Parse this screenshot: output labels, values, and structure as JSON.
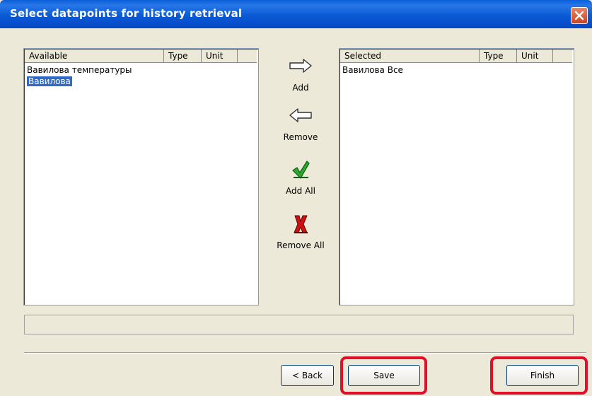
{
  "window": {
    "title": "Select datapoints for history retrieval"
  },
  "available": {
    "headers": [
      "Available",
      "Type",
      "Unit"
    ],
    "items": [
      {
        "label": "Вавилова температуры",
        "selected": false
      },
      {
        "label": "Вавилова",
        "selected": true
      }
    ]
  },
  "selected": {
    "headers": [
      "Selected",
      "Type",
      "Unit"
    ],
    "items": [
      {
        "label": "Вавилова Все"
      }
    ]
  },
  "actions": {
    "add": "Add",
    "remove": "Remove",
    "add_all": "Add All",
    "remove_all": "Remove All"
  },
  "footer": {
    "back": "< Back",
    "save": "Save",
    "finish": "Finish"
  },
  "colors": {
    "titlebar": "#0a5ad6",
    "highlight": "#e0102a",
    "selection": "#316ac5",
    "face": "#ece9d8"
  },
  "icons": [
    "arrow-right-icon",
    "arrow-left-icon",
    "green-check-icon",
    "red-x-icon",
    "close-icon"
  ]
}
